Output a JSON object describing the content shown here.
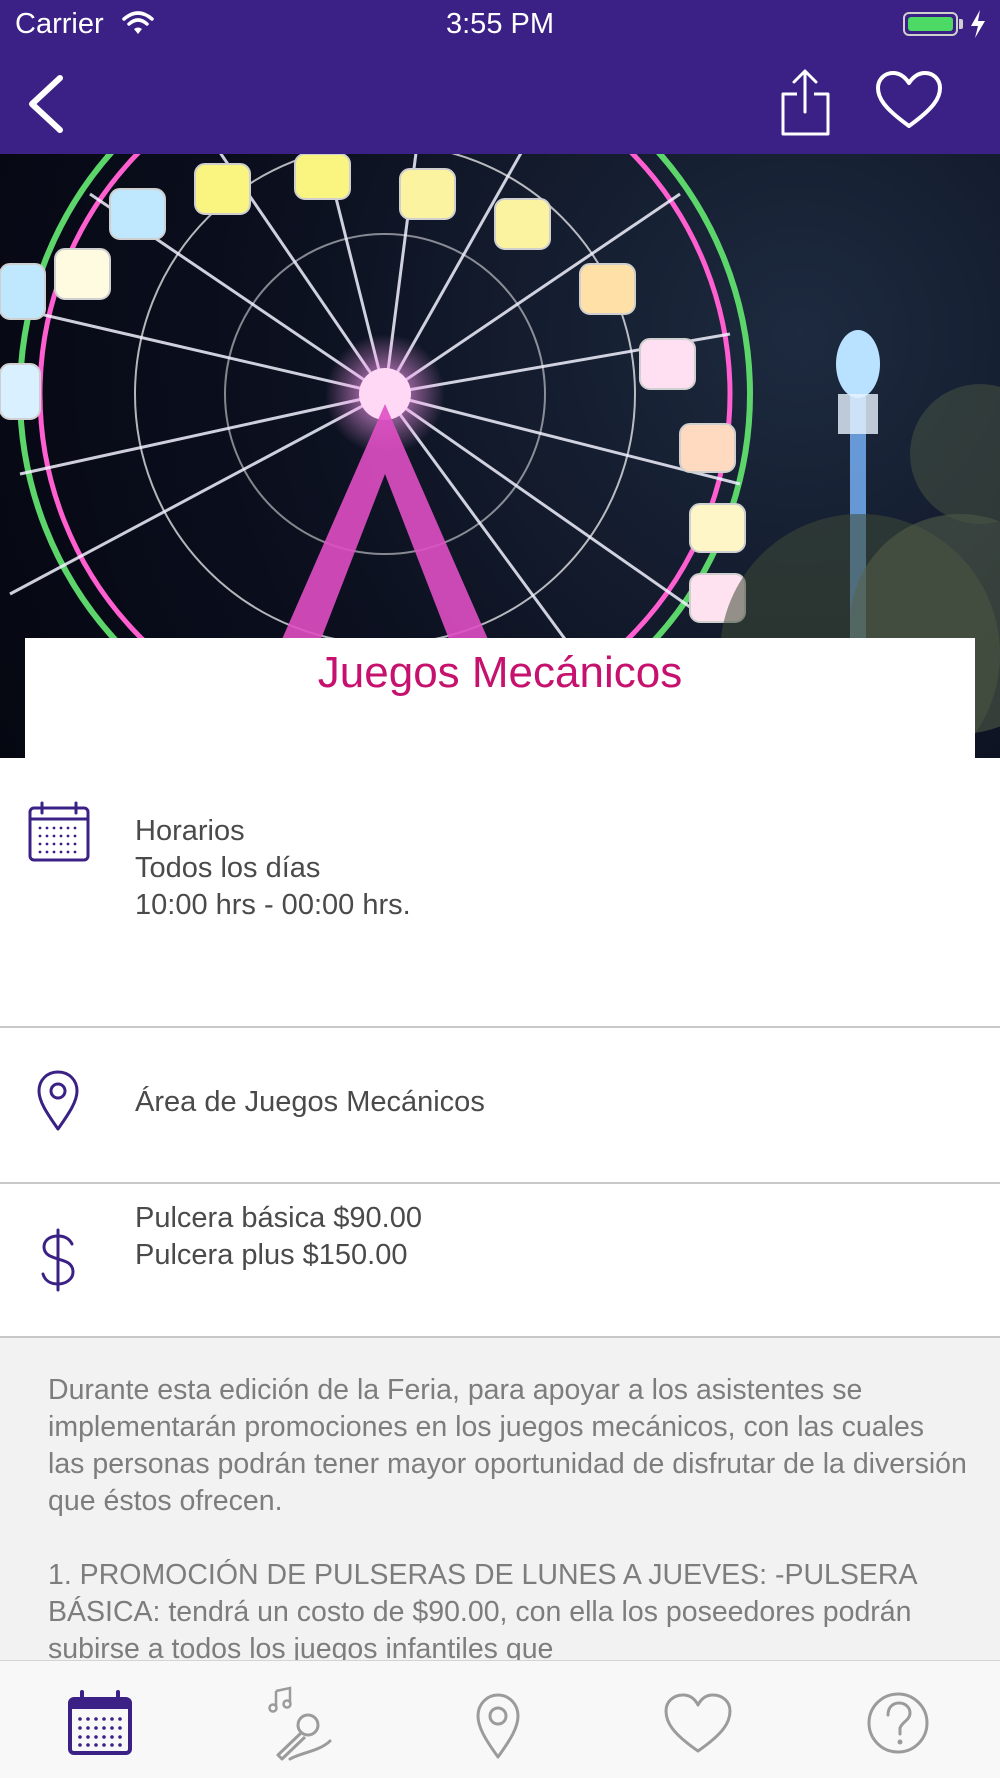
{
  "status_bar": {
    "carrier": "Carrier",
    "time": "3:55 PM"
  },
  "nav": {
    "back_icon": "chevron-left-icon",
    "share_icon": "share-icon",
    "favorite_icon": "heart-icon"
  },
  "hero": {
    "slide_count": 6,
    "active_slide": 1
  },
  "event": {
    "title": "Juegos Mecánicos"
  },
  "schedule": {
    "icon": "calendar-icon",
    "heading": "Horarios",
    "days": "Todos los días",
    "hours": "10:00 hrs - 00:00 hrs."
  },
  "location": {
    "icon": "map-pin-icon",
    "name": "Área de Juegos Mecánicos"
  },
  "price": {
    "icon": "dollar-icon",
    "basic": "Pulcera básica $90.00",
    "plus": "Pulcera plus $150.00"
  },
  "description": {
    "paragraph_1": "Durante esta edición de la Feria, para apoyar a los asistentes se implementarán promociones en los juegos mecánicos, con las cuales las personas podrán tener mayor oportunidad de disfrutar de la diversión que éstos ofrecen.",
    "paragraph_2": "1. PROMOCIÓN DE PULSERAS DE LUNES A JUEVES: -PULSERA BÁSICA: tendrá un costo de $90.00, con ella los poseedores podrán subirse a todos los juegos infantiles que"
  },
  "tabbar": {
    "tabs": [
      "calendar-icon",
      "singer-icon",
      "map-pin-icon",
      "heart-icon",
      "help-icon"
    ],
    "active_color": "#3b2085",
    "inactive_color": "#9b9b9b"
  },
  "colors": {
    "nav_background": "#3b2085",
    "accent": "#c6116f",
    "icon_purple": "#3b2085"
  }
}
